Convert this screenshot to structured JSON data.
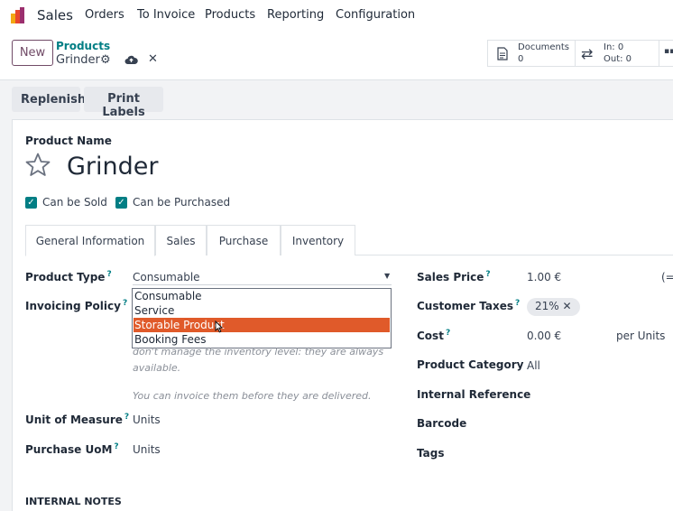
{
  "topbar": {
    "app_name": "Sales",
    "menu": [
      "Orders",
      "To Invoice",
      "Products",
      "Reporting",
      "Configuration"
    ]
  },
  "control_panel": {
    "new_label": "New",
    "breadcrumb_parent": "Products",
    "breadcrumb_current": "Grinder",
    "documents_label": "Documents",
    "documents_count": "0",
    "in_label": "In: 0",
    "out_label": "Out: 0"
  },
  "actions": {
    "replenish": "Replenish",
    "print_labels": "Print Labels"
  },
  "form": {
    "product_name_label": "Product Name",
    "product_name": "Grinder",
    "can_be_sold": "Can be Sold",
    "can_be_purchased": "Can be Purchased",
    "tabs": [
      "General Information",
      "Sales",
      "Purchase",
      "Inventory"
    ],
    "product_type_label": "Product Type",
    "product_type_value": "Consumable",
    "product_type_options": [
      "Consumable",
      "Service",
      "Storable Product",
      "Booking Fees"
    ],
    "invoicing_policy_label": "Invoicing Policy",
    "type_note_line1": "don't manage the inventory level: they are always",
    "type_note_line2": "available.",
    "invoice_note": "You can invoice them before they are delivered.",
    "uom_label": "Unit of Measure",
    "uom_value": "Units",
    "purchase_uom_label": "Purchase UoM",
    "purchase_uom_value": "Units",
    "internal_notes": "INTERNAL NOTES",
    "sales_price_label": "Sales Price",
    "sales_price_value": "1.00 €",
    "sales_price_extra": "(=",
    "customer_taxes_label": "Customer Taxes",
    "customer_taxes_value": "21%",
    "cost_label": "Cost",
    "cost_value": "0.00 €",
    "cost_unit": "per Units",
    "category_label": "Product Category",
    "category_value": "All",
    "internal_ref_label": "Internal Reference",
    "barcode_label": "Barcode",
    "tags_label": "Tags"
  },
  "colors": {
    "brand": "#714b67",
    "teal": "#017e84",
    "highlight": "#e05a2a"
  }
}
